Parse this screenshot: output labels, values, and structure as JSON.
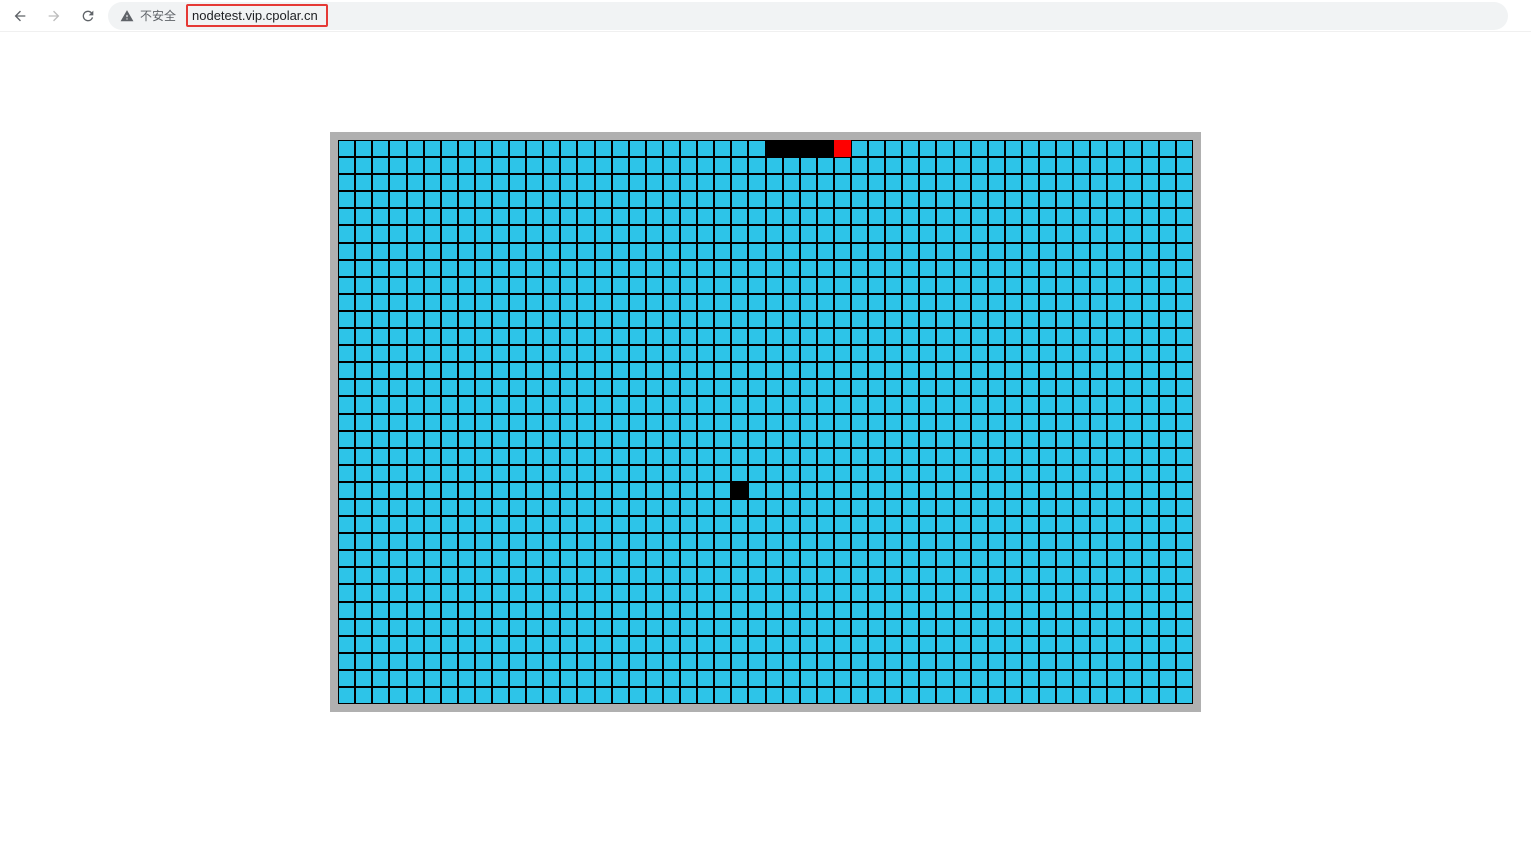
{
  "browser": {
    "security_label": "不安全",
    "url": "nodetest.vip.cpolar.cn"
  },
  "game": {
    "grid": {
      "cols": 50,
      "rows": 33
    },
    "colors": {
      "board_border": "#b0b0b0",
      "cell_bg": "#2dc4e8",
      "cell_border": "#000000",
      "snake": "#000000",
      "head": "#ff0000",
      "food": "#000000"
    },
    "snake_cells": [
      {
        "row": 0,
        "col": 25
      },
      {
        "row": 0,
        "col": 26
      },
      {
        "row": 0,
        "col": 27
      },
      {
        "row": 0,
        "col": 28
      }
    ],
    "head_cell": {
      "row": 0,
      "col": 29
    },
    "food_cell": {
      "row": 20,
      "col": 23
    }
  }
}
